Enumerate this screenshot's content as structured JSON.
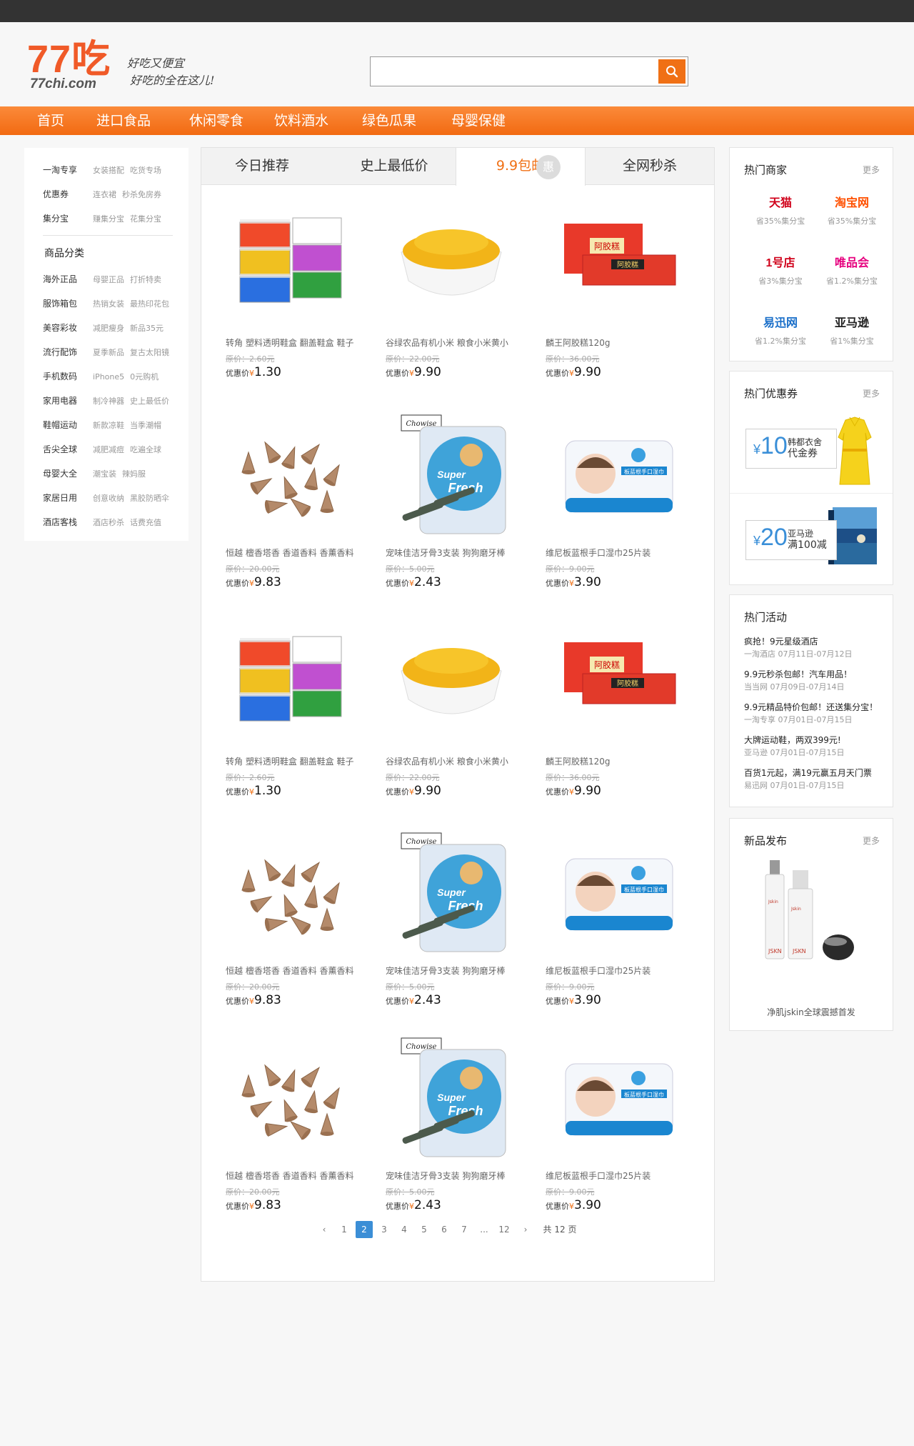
{
  "logo": {
    "main": "77吃",
    "sub": "77chi.com"
  },
  "slogan": {
    "line1": "好吃又便宜",
    "line2": "好吃的全在这儿!"
  },
  "search": {
    "placeholder": ""
  },
  "nav": [
    "首页",
    "进口食品",
    "休闲零食",
    "饮料酒水",
    "绿色瓜果",
    "母婴保健"
  ],
  "left": {
    "top": [
      {
        "label": "一淘专享",
        "subs": [
          "女装搭配",
          "吃货专场"
        ]
      },
      {
        "label": "优惠券",
        "subs": [
          "连衣裙",
          "秒杀免房券"
        ]
      },
      {
        "label": "集分宝",
        "subs": [
          "赚集分宝",
          "花集分宝"
        ]
      }
    ],
    "category_title": "商品分类",
    "categories": [
      {
        "label": "海外正品",
        "subs": [
          "母婴正品",
          "打折特卖"
        ]
      },
      {
        "label": "服饰箱包",
        "subs": [
          "热销女装",
          "最热印花包"
        ]
      },
      {
        "label": "美容彩妆",
        "subs": [
          "减肥瘦身",
          "新品35元"
        ]
      },
      {
        "label": "流行配饰",
        "subs": [
          "夏季新品",
          "复古太阳镜"
        ]
      },
      {
        "label": "手机数码",
        "subs": [
          "iPhone5",
          "0元购机"
        ]
      },
      {
        "label": "家用电器",
        "subs": [
          "制冷神器",
          "史上最低价"
        ]
      },
      {
        "label": "鞋帽运动",
        "subs": [
          "新款凉鞋",
          "当季潮帽"
        ]
      },
      {
        "label": "舌尖全球",
        "subs": [
          "减肥减痘",
          "吃遍全球"
        ]
      },
      {
        "label": "母婴大全",
        "subs": [
          "潮宝装",
          "辣妈服"
        ]
      },
      {
        "label": "家居日用",
        "subs": [
          "创意收纳",
          "黑胶防晒伞"
        ]
      },
      {
        "label": "酒店客栈",
        "subs": [
          "酒店秒杀",
          "话费充值"
        ]
      }
    ]
  },
  "tabs": [
    "今日推荐",
    "史上最低价",
    "9.9包邮",
    "全网秒杀"
  ],
  "tab_badge": "惠",
  "products": [
    {
      "title": "转角 塑料透明鞋盒 翻盖鞋盒 鞋子",
      "orig": "原价：2.60元",
      "deal_label": "优惠价",
      "yen": "¥",
      "price": "1.30",
      "img": "shoebox"
    },
    {
      "title": "谷绿农品有机小米 粮食小米黄小",
      "orig": "原价：22.00元",
      "deal_label": "优惠价",
      "yen": "¥",
      "price": "9.90",
      "img": "millet"
    },
    {
      "title": "麟王阿胶糕120g",
      "orig": "原价：36.00元",
      "deal_label": "优惠价",
      "yen": "¥",
      "price": "9.90",
      "img": "ejiao"
    },
    {
      "title": "恒越 檀香塔香 香道香料 香薰香料",
      "orig": "原价：20.00元",
      "deal_label": "优惠价",
      "yen": "¥",
      "price": "9.83",
      "img": "incense"
    },
    {
      "title": "宠味佳洁牙骨3支装 狗狗磨牙棒",
      "orig": "原价：5.00元",
      "deal_label": "优惠价",
      "yen": "¥",
      "price": "2.43",
      "img": "dogbone"
    },
    {
      "title": "维尼板蓝根手口湿巾25片装",
      "orig": "原价：9.00元",
      "deal_label": "优惠价",
      "yen": "¥",
      "price": "3.90",
      "img": "wipes"
    },
    {
      "title": "转角 塑料透明鞋盒 翻盖鞋盒 鞋子",
      "orig": "原价：2.60元",
      "deal_label": "优惠价",
      "yen": "¥",
      "price": "1.30",
      "img": "shoebox"
    },
    {
      "title": "谷绿农品有机小米 粮食小米黄小",
      "orig": "原价：22.00元",
      "deal_label": "优惠价",
      "yen": "¥",
      "price": "9.90",
      "img": "millet"
    },
    {
      "title": "麟王阿胶糕120g",
      "orig": "原价：36.00元",
      "deal_label": "优惠价",
      "yen": "¥",
      "price": "9.90",
      "img": "ejiao"
    },
    {
      "title": "恒越 檀香塔香 香道香料 香薰香料",
      "orig": "原价：20.00元",
      "deal_label": "优惠价",
      "yen": "¥",
      "price": "9.83",
      "img": "incense"
    },
    {
      "title": "宠味佳洁牙骨3支装 狗狗磨牙棒",
      "orig": "原价：5.00元",
      "deal_label": "优惠价",
      "yen": "¥",
      "price": "2.43",
      "img": "dogbone"
    },
    {
      "title": "维尼板蓝根手口湿巾25片装",
      "orig": "原价：9.00元",
      "deal_label": "优惠价",
      "yen": "¥",
      "price": "3.90",
      "img": "wipes"
    },
    {
      "title": "恒越 檀香塔香 香道香料 香薰香料",
      "orig": "原价：20.00元",
      "deal_label": "优惠价",
      "yen": "¥",
      "price": "9.83",
      "img": "incense"
    },
    {
      "title": "宠味佳洁牙骨3支装 狗狗磨牙棒",
      "orig": "原价：5.00元",
      "deal_label": "优惠价",
      "yen": "¥",
      "price": "2.43",
      "img": "dogbone"
    },
    {
      "title": "维尼板蓝根手口湿巾25片装",
      "orig": "原价：9.00元",
      "deal_label": "优惠价",
      "yen": "¥",
      "price": "3.90",
      "img": "wipes"
    }
  ],
  "product_image_text": {
    "ejiao_brand": "阿胶糕",
    "dog_brand": "Chowise",
    "dog_line1": "Super",
    "dog_line2": "Fresh",
    "wipes_label": "板蓝根手口湿巾"
  },
  "pagination": {
    "prev": "‹",
    "pages": [
      "1",
      "2",
      "3",
      "4",
      "5",
      "6",
      "7",
      "...",
      "12"
    ],
    "current": "2",
    "next": "›",
    "total": "共 12 页"
  },
  "right": {
    "merchants": {
      "title": "热门商家",
      "more": "更多",
      "items": [
        {
          "logo": "天猫",
          "color": "#d0021b",
          "desc": "省35%集分宝"
        },
        {
          "logo": "淘宝网",
          "color": "#ff5000",
          "desc": "省35%集分宝"
        },
        {
          "logo": "1号店",
          "color": "#d0021b",
          "desc": "省3%集分宝"
        },
        {
          "logo": "唯品会",
          "color": "#e6007e",
          "desc": "省1.2%集分宝"
        },
        {
          "logo": "易迅网",
          "color": "#1a6fc9",
          "desc": "省1.2%集分宝"
        },
        {
          "logo": "亚马逊",
          "color": "#222222",
          "desc": "省1%集分宝"
        }
      ]
    },
    "coupons": {
      "title": "热门优惠券",
      "more": "更多",
      "items": [
        {
          "yen": "¥",
          "amount": "10",
          "line1": "韩都衣舍",
          "line2": "代金券"
        },
        {
          "yen": "¥",
          "amount": "20",
          "line1": "亚马逊",
          "line2": "满100减"
        }
      ]
    },
    "activities": {
      "title": "热门活动",
      "items": [
        {
          "name": "疯抢！9元星级酒店",
          "meta": "一淘酒店 07月11日-07月12日"
        },
        {
          "name": "9.9元秒杀包邮！汽车用品！",
          "meta": "当当网 07月09日-07月14日"
        },
        {
          "name": "9.9元精品特价包邮！还送集分宝！",
          "meta": "一淘专享 07月01日-07月15日"
        },
        {
          "name": "大牌运动鞋，两双399元!",
          "meta": "亚马逊 07月01日-07月15日"
        },
        {
          "name": "百货1元起，满19元赢五月天门票",
          "meta": "易迅网 07月01日-07月15日"
        }
      ]
    },
    "newprod": {
      "title": "新品发布",
      "more": "更多",
      "caption": "净肌jskin全球震撼首发",
      "brand": "JSKN"
    }
  },
  "colors": {
    "accent": "#f07015",
    "nav": "#f57a24",
    "page_active": "#3b8ed6"
  }
}
